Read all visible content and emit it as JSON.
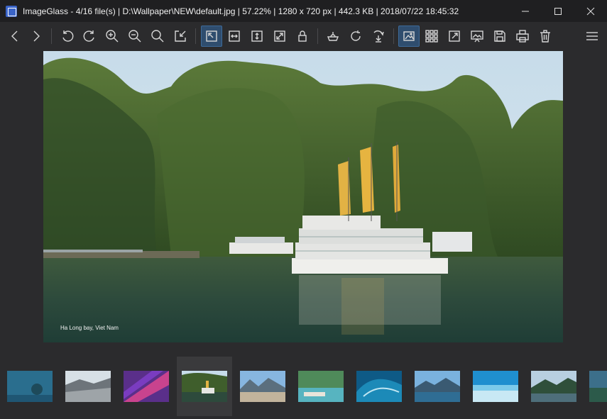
{
  "window": {
    "title": "ImageGlass - 4/16 file(s)  |  D:\\Wallpaper\\NEW\\default.jpg  |  57.22%  |  1280 x 720 px  |  442.3 KB  |  2018/07/22 18:45:32"
  },
  "toolbar": {
    "buttons": [
      {
        "name": "previous-image-icon"
      },
      {
        "name": "next-image-icon"
      },
      {
        "name": "rotate-left-icon"
      },
      {
        "name": "rotate-right-icon"
      },
      {
        "name": "zoom-in-icon"
      },
      {
        "name": "zoom-out-icon"
      },
      {
        "name": "zoom-to-fit-icon"
      },
      {
        "name": "actual-size-icon"
      },
      {
        "name": "auto-zoom-icon"
      },
      {
        "name": "scale-to-width-icon"
      },
      {
        "name": "scale-to-height-icon"
      },
      {
        "name": "scale-to-fill-icon"
      },
      {
        "name": "lock-zoom-icon"
      },
      {
        "name": "open-with-icon"
      },
      {
        "name": "refresh-icon"
      },
      {
        "name": "goto-image-icon"
      },
      {
        "name": "checkerboard-icon"
      },
      {
        "name": "thumbnail-bar-icon"
      },
      {
        "name": "fullscreen-icon"
      },
      {
        "name": "slideshow-icon"
      },
      {
        "name": "save-icon"
      },
      {
        "name": "print-icon"
      },
      {
        "name": "delete-icon"
      },
      {
        "name": "menu-icon"
      }
    ]
  },
  "image": {
    "caption": "Ha Long bay, Viet Nam"
  },
  "thumbnails": {
    "count": 11,
    "selected_index": 3
  }
}
